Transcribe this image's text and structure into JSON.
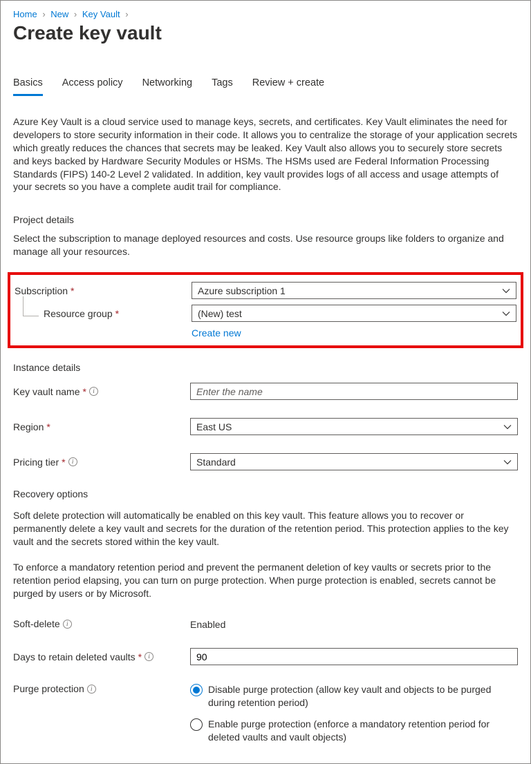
{
  "breadcrumb": {
    "items": [
      "Home",
      "New",
      "Key Vault"
    ]
  },
  "page_title": "Create key vault",
  "tabs": [
    {
      "label": "Basics",
      "active": true
    },
    {
      "label": "Access policy",
      "active": false
    },
    {
      "label": "Networking",
      "active": false
    },
    {
      "label": "Tags",
      "active": false
    },
    {
      "label": "Review + create",
      "active": false
    }
  ],
  "description": "Azure Key Vault is a cloud service used to manage keys, secrets, and certificates. Key Vault eliminates the need for developers to store security information in their code. It allows you to centralize the storage of your application secrets which greatly reduces the chances that secrets may be leaked. Key Vault also allows you to securely store secrets and keys backed by Hardware Security Modules or HSMs. The HSMs used are Federal Information Processing Standards (FIPS) 140-2 Level 2 validated. In addition, key vault provides logs of all access and usage attempts of your secrets so you have a complete audit trail for compliance.",
  "project_details": {
    "heading": "Project details",
    "text": "Select the subscription to manage deployed resources and costs. Use resource groups like folders to organize and manage all your resources.",
    "subscription_label": "Subscription",
    "subscription_value": "Azure subscription 1",
    "resource_group_label": "Resource group",
    "resource_group_value": "(New) test",
    "create_new_label": "Create new"
  },
  "instance_details": {
    "heading": "Instance details",
    "name_label": "Key vault name",
    "name_placeholder": "Enter the name",
    "name_value": "",
    "region_label": "Region",
    "region_value": "East US",
    "pricing_label": "Pricing tier",
    "pricing_value": "Standard"
  },
  "recovery_options": {
    "heading": "Recovery options",
    "text1": "Soft delete protection will automatically be enabled on this key vault. This feature allows you to recover or permanently delete a key vault and secrets for the duration of the retention period. This protection applies to the key vault and the secrets stored within the key vault.",
    "text2": "To enforce a mandatory retention period and prevent the permanent deletion of key vaults or secrets prior to the retention period elapsing, you can turn on purge protection. When purge protection is enabled, secrets cannot be purged by users or by Microsoft.",
    "soft_delete_label": "Soft-delete",
    "soft_delete_value": "Enabled",
    "retention_label": "Days to retain deleted vaults",
    "retention_value": "90",
    "purge_label": "Purge protection",
    "purge_options": [
      {
        "label": "Disable purge protection (allow key vault and objects to be purged during retention period)",
        "selected": true
      },
      {
        "label": "Enable purge protection (enforce a mandatory retention period for deleted vaults and vault objects)",
        "selected": false
      }
    ]
  }
}
